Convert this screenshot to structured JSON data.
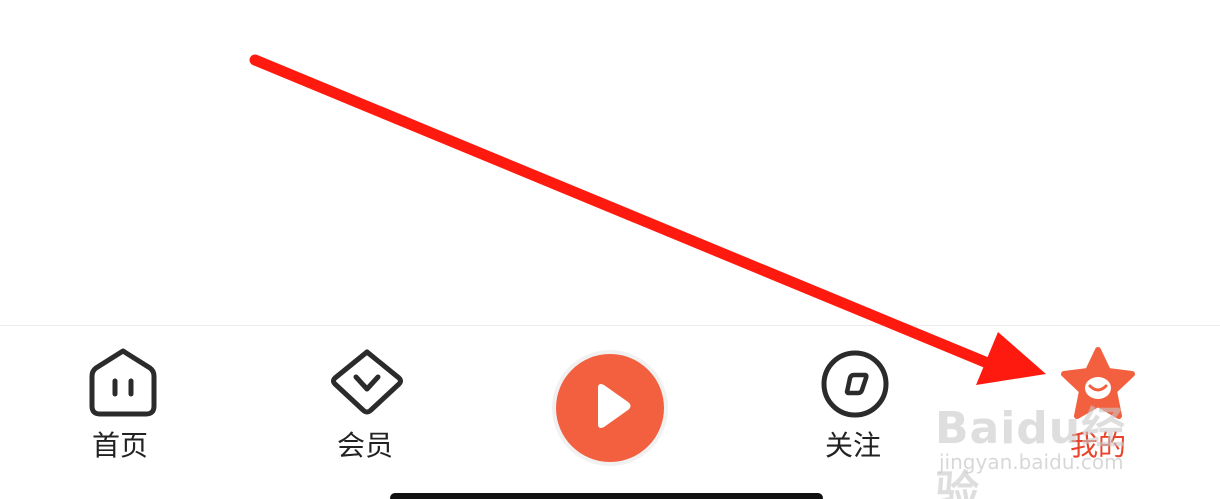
{
  "tabbar": {
    "items": [
      {
        "id": "home",
        "label": "首页",
        "icon": "home-icon",
        "active": false
      },
      {
        "id": "vip",
        "label": "会员",
        "icon": "diamond-icon",
        "active": false
      },
      {
        "id": "play",
        "label": "",
        "icon": "play-icon",
        "active": false
      },
      {
        "id": "follow",
        "label": "关注",
        "icon": "compass-icon",
        "active": false
      },
      {
        "id": "mine",
        "label": "我的",
        "icon": "star-face-icon",
        "active": true
      }
    ]
  },
  "watermark": {
    "brand": "Baidu经验",
    "url": "jingyan.baidu.com"
  },
  "colors": {
    "accent": "#f2603f",
    "active_label": "#e8442c",
    "icon_stroke": "#2b2b2b",
    "annotation_arrow": "#ff1a0f"
  }
}
